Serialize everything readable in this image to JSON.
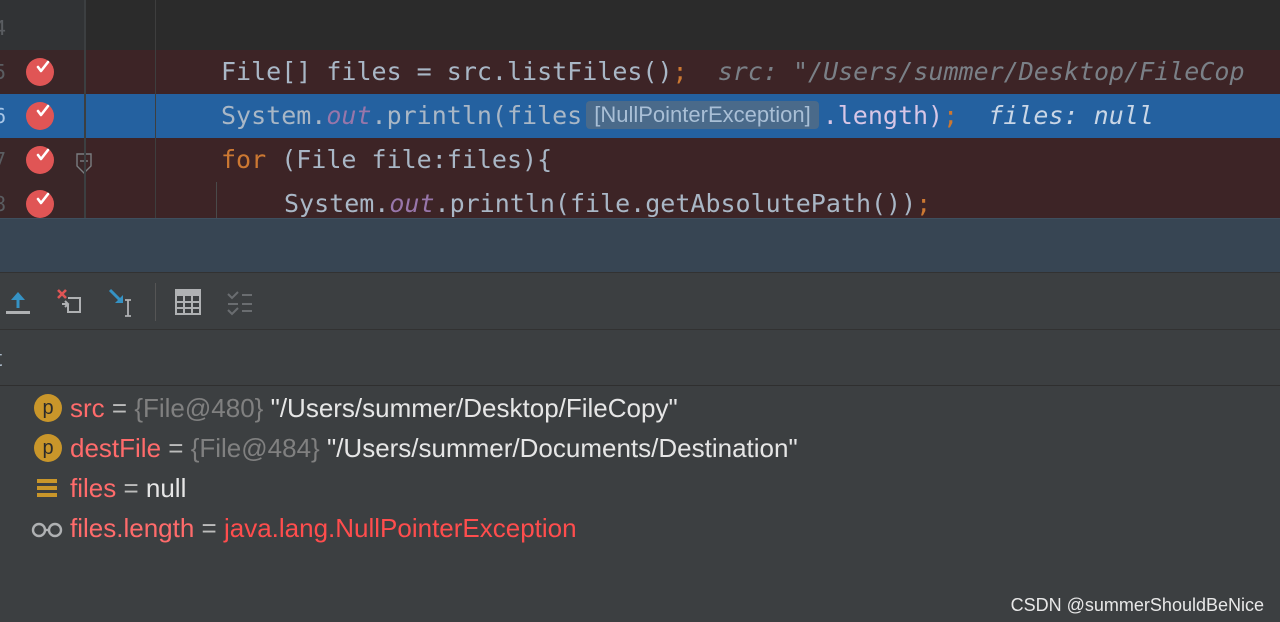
{
  "editor": {
    "lines": [
      {
        "number": "4"
      },
      {
        "number": "5",
        "breakpoint": true
      },
      {
        "number": "6",
        "breakpoint": true,
        "current": true
      },
      {
        "number": "7",
        "breakpoint": true,
        "foldable": true
      },
      {
        "number": "8",
        "breakpoint": true
      }
    ],
    "line5": {
      "code": "File[] files = src.listFiles()",
      "semi": ";",
      "hint": "src: \"/Users/summer/Desktop/FileCop"
    },
    "line6": {
      "code_a": "System.",
      "field": "out",
      "code_b": ".println(files",
      "inline_exception": "[NullPointerException]",
      "code_c": ".length)",
      "semi": ";",
      "hint": "files: null"
    },
    "line7": {
      "keyword": "for",
      "code": " (File file:files){"
    },
    "line8": {
      "code_a": "System.",
      "field": "out",
      "code_b": ".println(file.getAbsolutePath())",
      "semi": ";"
    }
  },
  "toolbar": {
    "icons": [
      "step-out-icon",
      "drop-frame-icon",
      "run-to-cursor-icon",
      "evaluate-expression-icon",
      "trace-icon"
    ]
  },
  "frames": {
    "partial_label": "t"
  },
  "variables": [
    {
      "icon": "p",
      "name": "src",
      "eq": " = ",
      "type": "{File@480}",
      "value": " \"/Users/summer/Desktop/FileCopy\""
    },
    {
      "icon": "p",
      "name": "destFile",
      "eq": " = ",
      "type": "{File@484}",
      "value": " \"/Users/summer/Documents/Destination\""
    },
    {
      "icon": "array",
      "name": "files",
      "eq": " = ",
      "value": "null"
    },
    {
      "icon": "watch",
      "name": "files.length",
      "eq": " = ",
      "value": "java.lang.NullPointerException"
    }
  ],
  "watermark": "CSDN @summerShouldBeNice",
  "colors": {
    "breakpoint_line": "#3d2426",
    "current_line": "#2461a0",
    "breakpoint_icon": "#e05555",
    "keyword": "#cc7832",
    "variable_name": "#ff6b6b",
    "error_value": "#ff4d4d"
  }
}
